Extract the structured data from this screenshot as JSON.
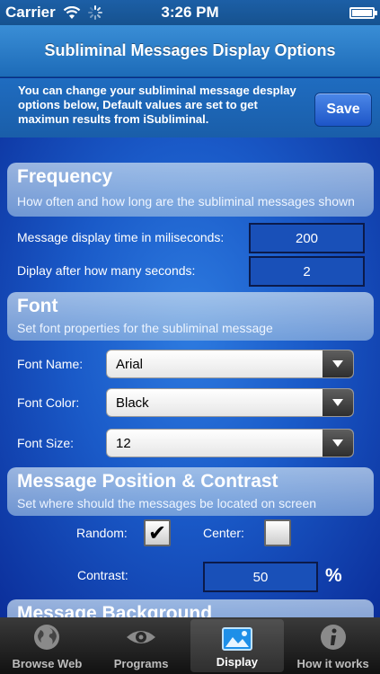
{
  "status": {
    "carrier": "Carrier",
    "time": "3:26 PM"
  },
  "nav": {
    "title": "Subliminal Messages Display Options"
  },
  "info": {
    "text": "You can change your subliminal message desplay options below, Default values are set to  get maximun results from iSubliminal.",
    "save_label": "Save"
  },
  "frequency": {
    "title": "Frequency",
    "subtitle": "How often and how long are the subliminal messages shown",
    "display_time_label": "Message display time in miliseconds:",
    "display_time_value": "200",
    "after_label": "Diplay after how many seconds:",
    "after_value": "2"
  },
  "font": {
    "title": "Font",
    "subtitle": "Set font properties for the subliminal message",
    "name_label": "Font Name:",
    "name_value": "Arial",
    "color_label": "Font Color:",
    "color_value": "Black",
    "size_label": "Font Size:",
    "size_value": "12"
  },
  "position": {
    "title": "Message Position & Contrast",
    "subtitle": "Set where should the messages be located on screen",
    "random_label": "Random:",
    "random_checked": "✔",
    "center_label": "Center:",
    "contrast_label": "Contrast:",
    "contrast_value": "50",
    "percent": "%"
  },
  "background": {
    "title": "Message Background"
  },
  "tabs": [
    {
      "label": "Browse Web",
      "icon": "globe-icon"
    },
    {
      "label": "Programs",
      "icon": "eye-icon"
    },
    {
      "label": "Display",
      "icon": "picture-icon"
    },
    {
      "label": "How it works",
      "icon": "info-icon"
    }
  ]
}
